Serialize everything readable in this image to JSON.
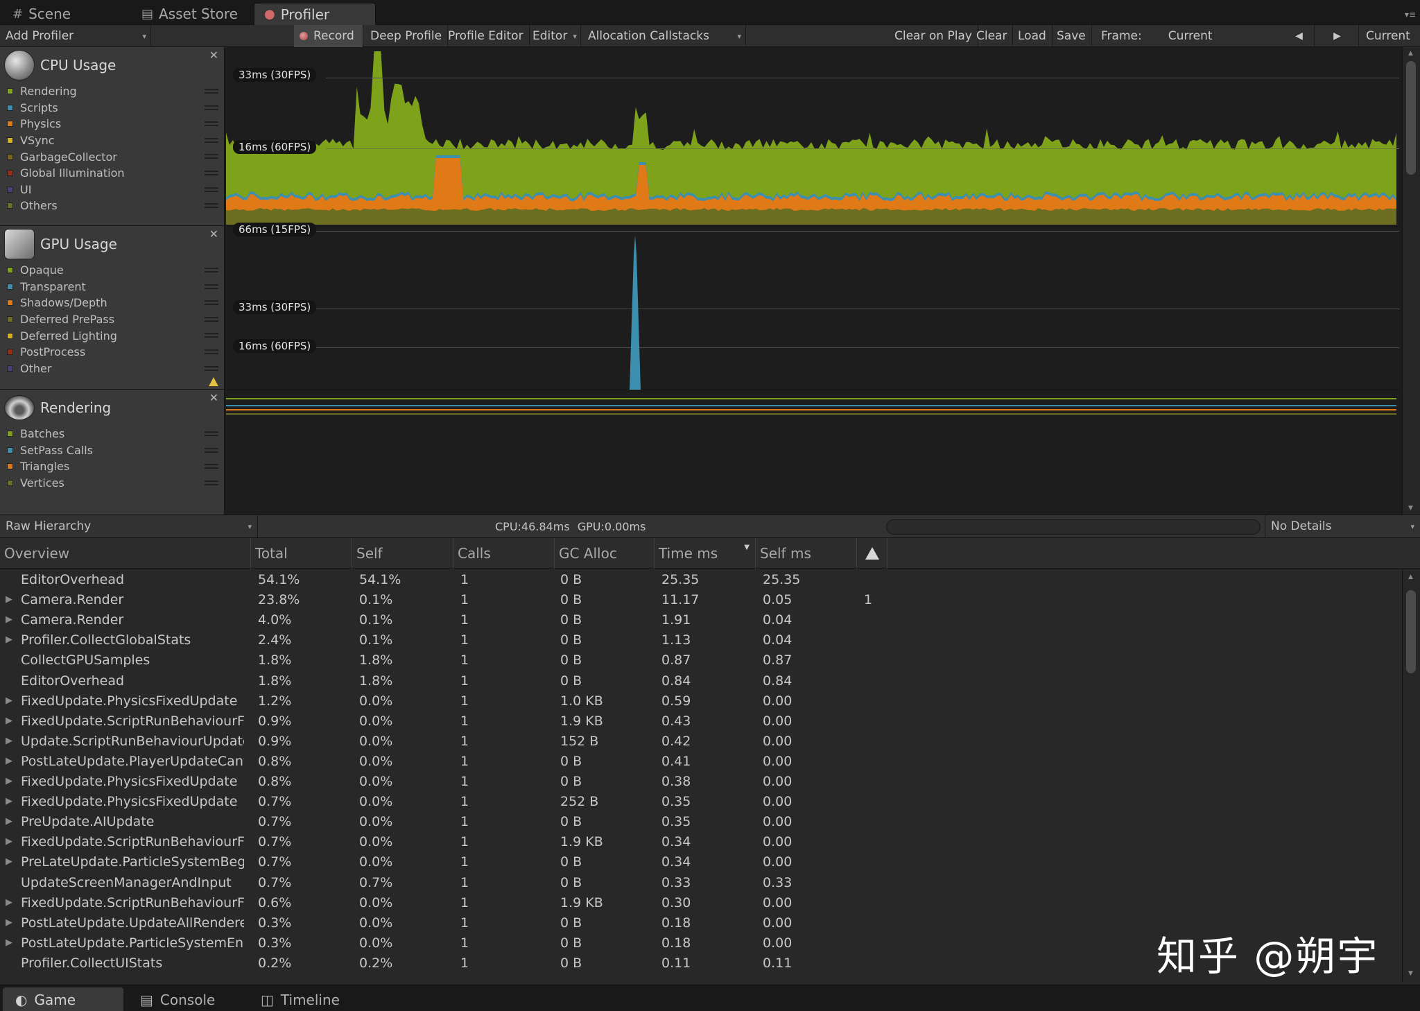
{
  "window_tabs": [
    {
      "label": "Scene",
      "icon": "scene-grid-icon"
    },
    {
      "label": "Asset Store",
      "icon": "asset-store-icon"
    },
    {
      "label": "Profiler",
      "icon": "profiler-icon",
      "active": true
    }
  ],
  "toolbar": {
    "add_profiler": "Add Profiler",
    "record": "Record",
    "deep_profile": "Deep Profile",
    "profile_editor": "Profile Editor",
    "editor": "Editor",
    "allocation_callstacks": "Allocation Callstacks",
    "clear_on_play": "Clear on Play",
    "clear": "Clear",
    "load": "Load",
    "save": "Save",
    "frame_label": "Frame:",
    "frame_value": "Current",
    "prev_frame": "◀",
    "next_frame": "▶",
    "current": "Current"
  },
  "modules": {
    "cpu": {
      "title": "CPU Usage",
      "items": [
        {
          "label": "Rendering",
          "color": "#7ea31a"
        },
        {
          "label": "Scripts",
          "color": "#3d8fb0"
        },
        {
          "label": "Physics",
          "color": "#e07a16"
        },
        {
          "label": "VSync",
          "color": "#d4b21e"
        },
        {
          "label": "GarbageCollector",
          "color": "#7d6319"
        },
        {
          "label": "Global Illumination",
          "color": "#9b2d16"
        },
        {
          "label": "UI",
          "color": "#4d3d7a"
        },
        {
          "label": "Others",
          "color": "#6e6e22"
        }
      ],
      "fps_labels": [
        "33ms (30FPS)",
        "16ms (60FPS)"
      ]
    },
    "gpu": {
      "title": "GPU Usage",
      "items": [
        {
          "label": "Opaque",
          "color": "#7ea31a"
        },
        {
          "label": "Transparent",
          "color": "#3d8fb0"
        },
        {
          "label": "Shadows/Depth",
          "color": "#e07a16"
        },
        {
          "label": "Deferred PrePass",
          "color": "#6e6e22"
        },
        {
          "label": "Deferred Lighting",
          "color": "#d4b21e"
        },
        {
          "label": "PostProcess",
          "color": "#9b2d16"
        },
        {
          "label": "Other",
          "color": "#4d3d7a"
        }
      ],
      "fps_labels": [
        "66ms (15FPS)",
        "33ms (30FPS)",
        "16ms (60FPS)"
      ]
    },
    "rendering": {
      "title": "Rendering",
      "items": [
        {
          "label": "Batches",
          "color": "#7ea31a"
        },
        {
          "label": "SetPass Calls",
          "color": "#3d8fb0"
        },
        {
          "label": "Triangles",
          "color": "#e07a16"
        },
        {
          "label": "Vertices",
          "color": "#6e6e22"
        }
      ]
    }
  },
  "details": {
    "view_mode": "Raw Hierarchy",
    "cpu_stat": "CPU:46.84ms",
    "gpu_stat": "GPU:0.00ms",
    "search_placeholder": "",
    "details_mode": "No Details"
  },
  "table": {
    "columns": [
      "Overview",
      "Total",
      "Self",
      "Calls",
      "GC Alloc",
      "Time ms",
      "Self ms"
    ],
    "rows": [
      {
        "name": "EditorOverhead",
        "total": "54.1%",
        "self": "54.1%",
        "calls": "1",
        "gc": "0 B",
        "time": "25.35",
        "selfms": "25.35",
        "warn": "",
        "expandable": false
      },
      {
        "name": "Camera.Render",
        "total": "23.8%",
        "self": "0.1%",
        "calls": "1",
        "gc": "0 B",
        "time": "11.17",
        "selfms": "0.05",
        "warn": "1",
        "expandable": true
      },
      {
        "name": "Camera.Render",
        "total": "4.0%",
        "self": "0.1%",
        "calls": "1",
        "gc": "0 B",
        "time": "1.91",
        "selfms": "0.04",
        "warn": "",
        "expandable": true
      },
      {
        "name": "Profiler.CollectGlobalStats",
        "total": "2.4%",
        "self": "0.1%",
        "calls": "1",
        "gc": "0 B",
        "time": "1.13",
        "selfms": "0.04",
        "warn": "",
        "expandable": true
      },
      {
        "name": "CollectGPUSamples",
        "total": "1.8%",
        "self": "1.8%",
        "calls": "1",
        "gc": "0 B",
        "time": "0.87",
        "selfms": "0.87",
        "warn": "",
        "expandable": false
      },
      {
        "name": "EditorOverhead",
        "total": "1.8%",
        "self": "1.8%",
        "calls": "1",
        "gc": "0 B",
        "time": "0.84",
        "selfms": "0.84",
        "warn": "",
        "expandable": false
      },
      {
        "name": "FixedUpdate.PhysicsFixedUpdate",
        "total": "1.2%",
        "self": "0.0%",
        "calls": "1",
        "gc": "1.0 KB",
        "time": "0.59",
        "selfms": "0.00",
        "warn": "",
        "expandable": true
      },
      {
        "name": "FixedUpdate.ScriptRunBehaviourF",
        "total": "0.9%",
        "self": "0.0%",
        "calls": "1",
        "gc": "1.9 KB",
        "time": "0.43",
        "selfms": "0.00",
        "warn": "",
        "expandable": true
      },
      {
        "name": "Update.ScriptRunBehaviourUpdate",
        "total": "0.9%",
        "self": "0.0%",
        "calls": "1",
        "gc": "152 B",
        "time": "0.42",
        "selfms": "0.00",
        "warn": "",
        "expandable": true
      },
      {
        "name": "PostLateUpdate.PlayerUpdateCanv",
        "total": "0.8%",
        "self": "0.0%",
        "calls": "1",
        "gc": "0 B",
        "time": "0.41",
        "selfms": "0.00",
        "warn": "",
        "expandable": true
      },
      {
        "name": "FixedUpdate.PhysicsFixedUpdate",
        "total": "0.8%",
        "self": "0.0%",
        "calls": "1",
        "gc": "0 B",
        "time": "0.38",
        "selfms": "0.00",
        "warn": "",
        "expandable": true
      },
      {
        "name": "FixedUpdate.PhysicsFixedUpdate",
        "total": "0.7%",
        "self": "0.0%",
        "calls": "1",
        "gc": "252 B",
        "time": "0.35",
        "selfms": "0.00",
        "warn": "",
        "expandable": true
      },
      {
        "name": "PreUpdate.AIUpdate",
        "total": "0.7%",
        "self": "0.0%",
        "calls": "1",
        "gc": "0 B",
        "time": "0.35",
        "selfms": "0.00",
        "warn": "",
        "expandable": true
      },
      {
        "name": "FixedUpdate.ScriptRunBehaviourF",
        "total": "0.7%",
        "self": "0.0%",
        "calls": "1",
        "gc": "1.9 KB",
        "time": "0.34",
        "selfms": "0.00",
        "warn": "",
        "expandable": true
      },
      {
        "name": "PreLateUpdate.ParticleSystemBegi",
        "total": "0.7%",
        "self": "0.0%",
        "calls": "1",
        "gc": "0 B",
        "time": "0.34",
        "selfms": "0.00",
        "warn": "",
        "expandable": true
      },
      {
        "name": "UpdateScreenManagerAndInput",
        "total": "0.7%",
        "self": "0.7%",
        "calls": "1",
        "gc": "0 B",
        "time": "0.33",
        "selfms": "0.33",
        "warn": "",
        "expandable": false
      },
      {
        "name": "FixedUpdate.ScriptRunBehaviourF",
        "total": "0.6%",
        "self": "0.0%",
        "calls": "1",
        "gc": "1.9 KB",
        "time": "0.30",
        "selfms": "0.00",
        "warn": "",
        "expandable": true
      },
      {
        "name": "PostLateUpdate.UpdateAllRendere",
        "total": "0.3%",
        "self": "0.0%",
        "calls": "1",
        "gc": "0 B",
        "time": "0.18",
        "selfms": "0.00",
        "warn": "",
        "expandable": true
      },
      {
        "name": "PostLateUpdate.ParticleSystemEnd",
        "total": "0.3%",
        "self": "0.0%",
        "calls": "1",
        "gc": "0 B",
        "time": "0.18",
        "selfms": "0.00",
        "warn": "",
        "expandable": true
      },
      {
        "name": "Profiler.CollectUIStats",
        "total": "0.2%",
        "self": "0.2%",
        "calls": "1",
        "gc": "0 B",
        "time": "0.11",
        "selfms": "0.11",
        "warn": "",
        "expandable": false
      }
    ]
  },
  "watermark": "知乎 @朔宇",
  "bottom_tabs": [
    {
      "label": "Game",
      "icon": "game-icon",
      "active": true
    },
    {
      "label": "Console",
      "icon": "console-icon"
    },
    {
      "label": "Timeline",
      "icon": "timeline-icon"
    }
  ]
}
